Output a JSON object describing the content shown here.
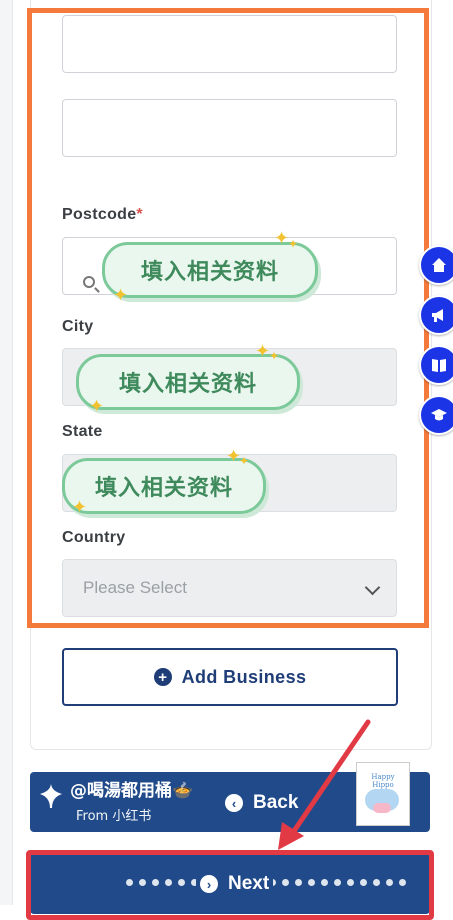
{
  "form": {
    "field_1_value": "",
    "field_2_value": "",
    "postcode": {
      "label": "Postcode",
      "required_mark": "*",
      "value": ""
    },
    "city": {
      "label": "City",
      "value": ""
    },
    "state": {
      "label": "State",
      "value": ""
    },
    "country": {
      "label": "Country",
      "placeholder": "Please Select"
    }
  },
  "stickers": {
    "postcode_note": "填入相关资料",
    "city_note": "填入相关资料",
    "state_note": "填入相关资料"
  },
  "add_business": {
    "label": "Add Business",
    "icon": "plus-circle-icon"
  },
  "watermark": {
    "user": "@喝湯都用桶",
    "emoji": "🍲",
    "from": "From 小红书"
  },
  "navigation": {
    "back_label": "Back",
    "next_label": "Next",
    "back_icon": "chevron-left-circle-icon",
    "next_icon": "chevron-right-circle-icon"
  },
  "floating_menu": [
    "home-icon",
    "megaphone-icon",
    "book-icon",
    "graduation-cap-icon"
  ],
  "thumbnail_caption": "Happy Hippo",
  "colors": {
    "highlight_orange": "#f47a3c",
    "highlight_red": "#e23a45",
    "primary_navy": "#214a8a",
    "float_blue": "#1b35e6",
    "sticker_green": "#7cc99a"
  }
}
